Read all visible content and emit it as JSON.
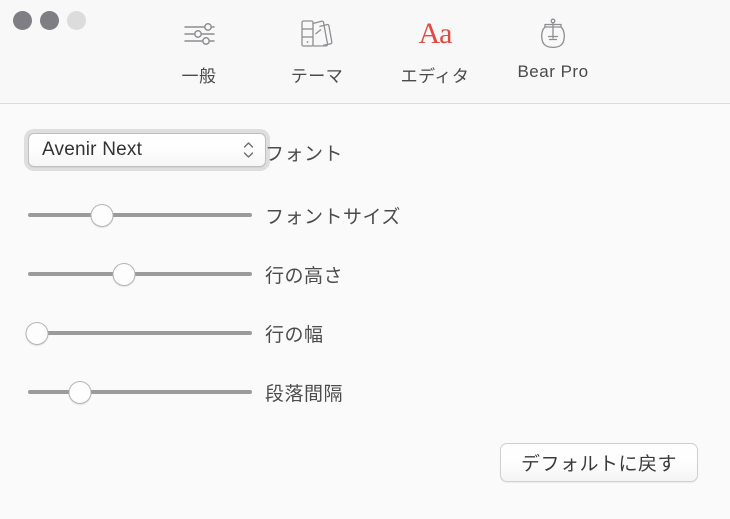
{
  "window": {
    "traffic_lights": [
      {
        "name": "close",
        "color": "#7e7e84"
      },
      {
        "name": "minimize",
        "color": "#7e7e84"
      },
      {
        "name": "zoom",
        "color": "#dcdcdc"
      }
    ]
  },
  "toolbar": {
    "tabs": [
      {
        "id": "general",
        "label": "一般",
        "icon": "sliders-icon",
        "selected": false
      },
      {
        "id": "theme",
        "label": "テーマ",
        "icon": "palette-icon",
        "selected": false
      },
      {
        "id": "editor",
        "label": "エディタ",
        "icon": "aa-icon",
        "selected": true,
        "icon_text": "Aa",
        "accent": "#e04a43"
      },
      {
        "id": "bear-pro",
        "label": "Bear Pro",
        "icon": "honeypot-icon",
        "selected": false
      }
    ]
  },
  "settings": {
    "font": {
      "label": "フォント",
      "value": "Avenir Next",
      "control": "popup-button"
    },
    "font_size": {
      "label": "フォントサイズ",
      "control": "slider",
      "value_percent": 33
    },
    "line_height": {
      "label": "行の高さ",
      "control": "slider",
      "value_percent": 43
    },
    "line_width": {
      "label": "行の幅",
      "control": "slider",
      "value_percent": 4
    },
    "paragraph_spacing": {
      "label": "段落間隔",
      "control": "slider",
      "value_percent": 23
    }
  },
  "actions": {
    "restore_defaults": "デフォルトに戻す"
  }
}
